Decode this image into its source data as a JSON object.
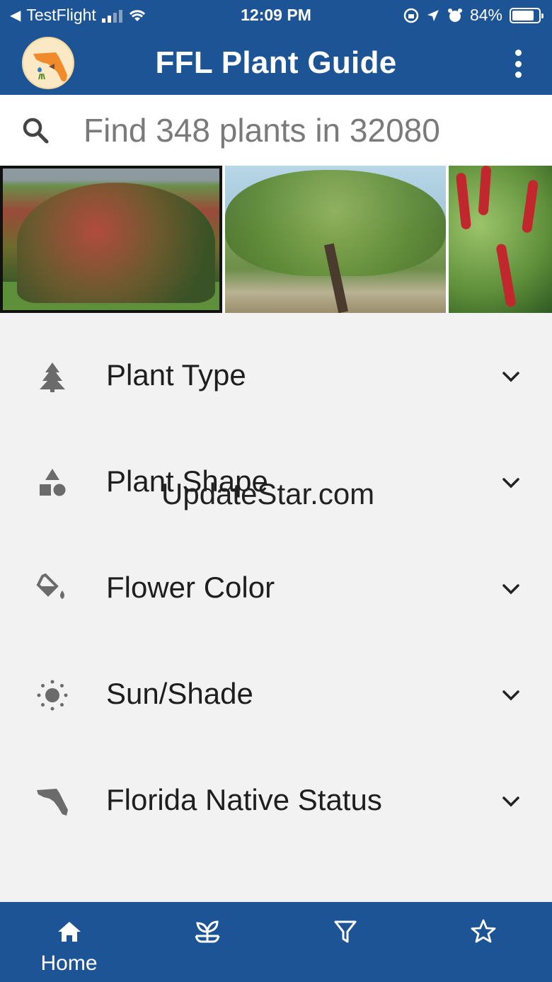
{
  "status_bar": {
    "back_app": "TestFlight",
    "time": "12:09 PM",
    "battery": "84%",
    "battery_level": 0.84
  },
  "header": {
    "title": "FFL Plant Guide",
    "logo_icon": "florida-logo-icon",
    "menu_icon": "more-vert-icon"
  },
  "search": {
    "placeholder": "Find 348 plants in 32080",
    "value": ""
  },
  "gallery": {
    "photos": [
      {
        "name": "red-shrub-photo"
      },
      {
        "name": "tree-garden-photo"
      },
      {
        "name": "chenille-plant-photo"
      }
    ]
  },
  "filters": [
    {
      "label": "Plant Type",
      "icon": "tree-icon"
    },
    {
      "label": "Plant Shape",
      "icon": "shapes-icon"
    },
    {
      "label": "Flower Color",
      "icon": "paint-bucket-icon"
    },
    {
      "label": "Sun/Shade",
      "icon": "sun-icon"
    },
    {
      "label": "Florida Native Status",
      "icon": "florida-map-icon"
    }
  ],
  "watermark": "UpdateStar.com",
  "tab_bar": {
    "tabs": [
      {
        "label": "Home",
        "icon": "home-icon",
        "active": true
      },
      {
        "label": "",
        "icon": "sprout-icon",
        "active": false
      },
      {
        "label": "",
        "icon": "filter-icon",
        "active": false
      },
      {
        "label": "",
        "icon": "star-icon",
        "active": false
      }
    ]
  },
  "colors": {
    "brand_blue": "#1c5496",
    "background": "#f2f2f2",
    "icon_gray": "#6b6b6b"
  }
}
